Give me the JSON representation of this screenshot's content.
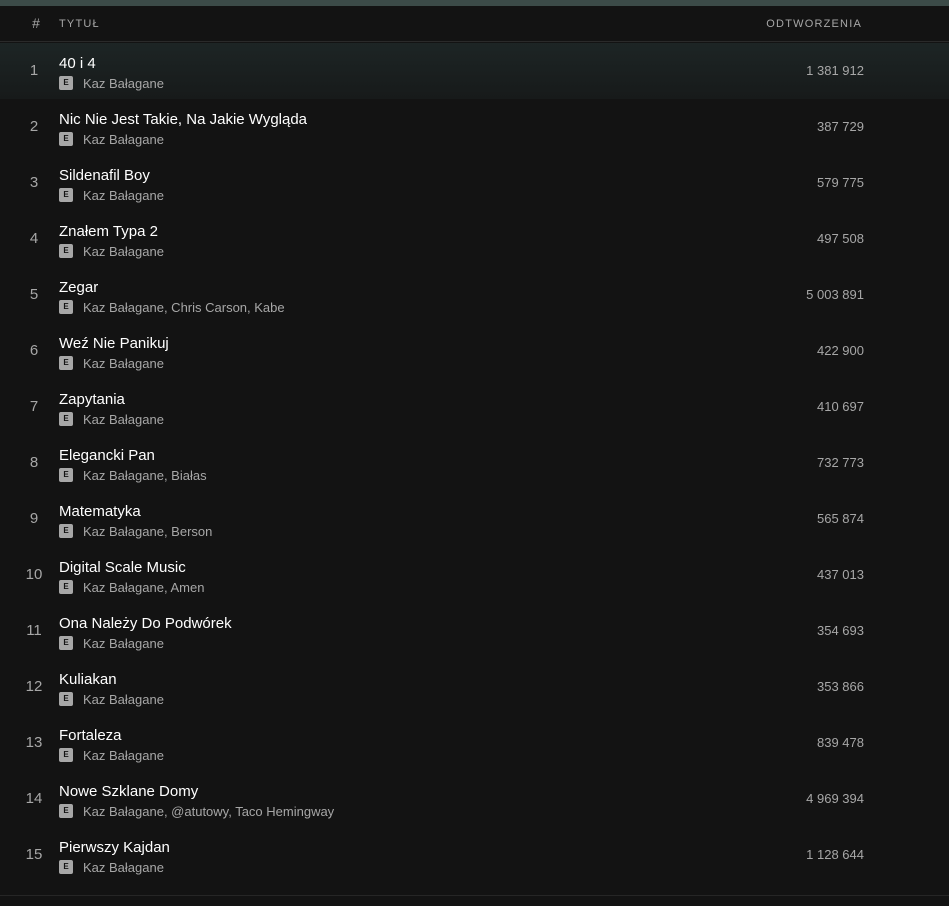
{
  "header": {
    "number": "#",
    "title": "TYTUŁ",
    "plays": "ODTWORZENIA"
  },
  "explicit_label": "E",
  "tracks": [
    {
      "number": "1",
      "title": "40 i 4",
      "artists": "Kaz Bałagane",
      "plays": "1 381 912",
      "active": true
    },
    {
      "number": "2",
      "title": "Nic Nie Jest Takie, Na Jakie Wygląda",
      "artists": "Kaz Bałagane",
      "plays": "387 729"
    },
    {
      "number": "3",
      "title": "Sildenafil Boy",
      "artists": "Kaz Bałagane",
      "plays": "579 775"
    },
    {
      "number": "4",
      "title": "Znałem Typa 2",
      "artists": "Kaz Bałagane",
      "plays": "497 508"
    },
    {
      "number": "5",
      "title": "Zegar",
      "artists": "Kaz Bałagane, Chris Carson, Kabe",
      "plays": "5 003 891"
    },
    {
      "number": "6",
      "title": "Weź Nie Panikuj",
      "artists": "Kaz Bałagane",
      "plays": "422 900"
    },
    {
      "number": "7",
      "title": "Zapytania",
      "artists": "Kaz Bałagane",
      "plays": "410 697"
    },
    {
      "number": "8",
      "title": "Elegancki Pan",
      "artists": "Kaz Bałagane, Białas",
      "plays": "732 773"
    },
    {
      "number": "9",
      "title": "Matematyka",
      "artists": "Kaz Bałagane, Berson",
      "plays": "565 874"
    },
    {
      "number": "10",
      "title": "Digital Scale Music",
      "artists": "Kaz Bałagane, Amen",
      "plays": "437 013"
    },
    {
      "number": "11",
      "title": "Ona Należy Do Podwórek",
      "artists": "Kaz Bałagane",
      "plays": "354 693"
    },
    {
      "number": "12",
      "title": "Kuliakan",
      "artists": "Kaz Bałagane",
      "plays": "353 866"
    },
    {
      "number": "13",
      "title": "Fortaleza",
      "artists": "Kaz Bałagane",
      "plays": "839 478"
    },
    {
      "number": "14",
      "title": "Nowe Szklane Domy",
      "artists": "Kaz Bałagane, @atutowy, Taco Hemingway",
      "plays": "4 969 394"
    },
    {
      "number": "15",
      "title": "Pierwszy Kajdan",
      "artists": "Kaz Bałagane",
      "plays": "1 128 644"
    }
  ]
}
